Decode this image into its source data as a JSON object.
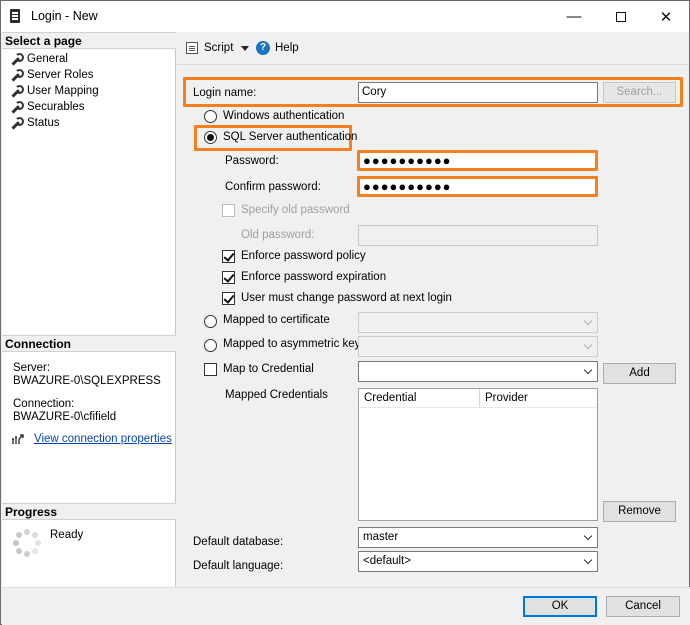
{
  "window": {
    "title": "Login - New"
  },
  "left": {
    "select_page_heading": "Select a page",
    "pages": [
      "General",
      "Server Roles",
      "User Mapping",
      "Securables",
      "Status"
    ],
    "connection_heading": "Connection",
    "server_label": "Server:",
    "server_value": "BWAZURE-0\\SQLEXPRESS",
    "connection_label": "Connection:",
    "connection_value": "BWAZURE-0\\cfifield",
    "view_props_link": "View connection properties",
    "progress_heading": "Progress",
    "progress_status": "Ready"
  },
  "toolbar": {
    "script_label": "Script",
    "help_label": "Help"
  },
  "form": {
    "login_name_label": "Login name:",
    "login_name_value": "Cory",
    "search_button": "Search...",
    "windows_auth": "Windows authentication",
    "sql_auth": "SQL Server authentication",
    "password_label": "Password:",
    "password_value": "●●●●●●●●●●",
    "confirm_label": "Confirm password:",
    "confirm_value": "●●●●●●●●●●",
    "specify_old": "Specify old password",
    "old_password_label": "Old password:",
    "enforce_policy": "Enforce password policy",
    "enforce_expiration": "Enforce password expiration",
    "must_change": "User must change password at next login",
    "mapped_cert": "Mapped to certificate",
    "mapped_asym": "Mapped to asymmetric key",
    "map_credential": "Map to Credential",
    "add_button": "Add",
    "mapped_credentials_label": "Mapped Credentials",
    "grid_col_credential": "Credential",
    "grid_col_provider": "Provider",
    "remove_button": "Remove",
    "default_db_label": "Default database:",
    "default_db_value": "master",
    "default_lang_label": "Default language:",
    "default_lang_value": "<default>"
  },
  "footer": {
    "ok": "OK",
    "cancel": "Cancel"
  }
}
